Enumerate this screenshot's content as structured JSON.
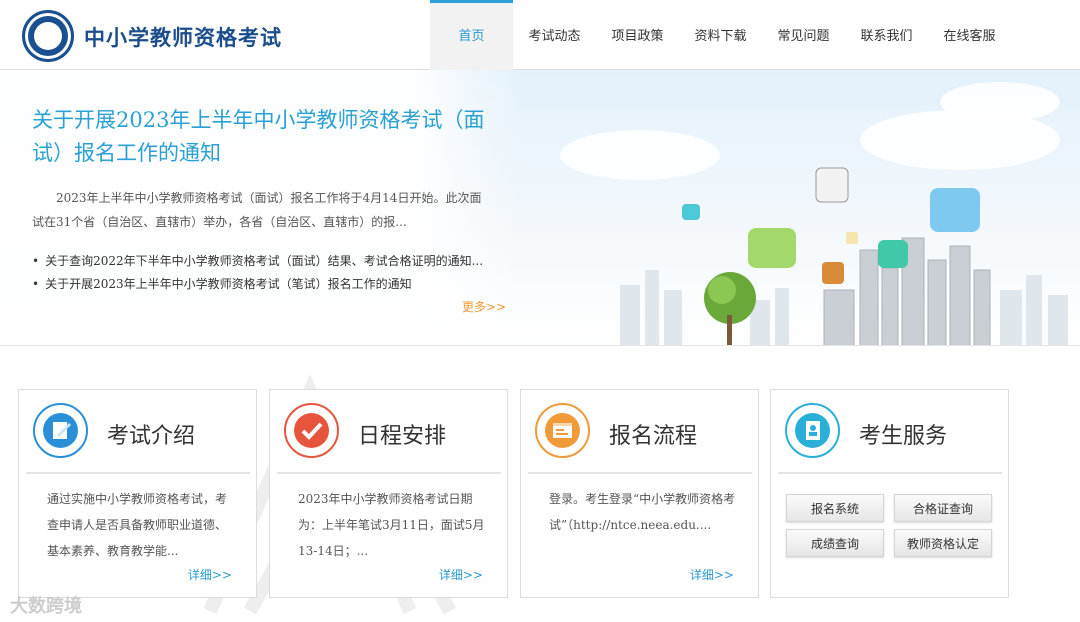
{
  "header": {
    "site_title": "中小学教师资格考试",
    "nav": [
      "首页",
      "考试动态",
      "项目政策",
      "资料下载",
      "常见问题",
      "联系我们",
      "在线客服"
    ]
  },
  "banner": {
    "title": "关于开展2023年上半年中小学教师资格考试（面试）报名工作的通知",
    "description": "2023年上半年中小学教师资格考试（面试）报名工作将于4月14日开始。此次面试在31个省（自治区、直辖市）举办，各省（自治区、直辖市）的报...",
    "news": [
      "关于查询2022年下半年中小学教师资格考试（面试）结果、考试合格证明的通知...",
      "关于开展2023年上半年中小学教师资格考试（笔试）报名工作的通知"
    ],
    "more": "更多>>"
  },
  "cards": [
    {
      "title": "考试介绍",
      "text": "通过实施中小学教师资格考试，考查申请人是否具备教师职业道德、基本素养、教育教学能...",
      "more": "详细>>"
    },
    {
      "title": "日程安排",
      "text": "2023年中小学教师资格考试日期为：上半年笔试3月11日，面试5月13-14日；...",
      "more": "详细>>"
    },
    {
      "title": "报名流程",
      "text": "登录。考生登录“中小学教师资格考试”（http://ntce.neea.edu....",
      "more": "详细>>"
    },
    {
      "title": "考生服务",
      "buttons": [
        "报名系统",
        "合格证查询",
        "成绩查询",
        "教师资格认定"
      ]
    }
  ],
  "watermark": "大数跨境",
  "colors": {
    "accent": "#2aa0d4",
    "brand": "#1d4d8c",
    "more": "#f39a33",
    "card1": "#2b8fd8",
    "card2": "#e8553e",
    "card3": "#f09a3a",
    "card4": "#2ab0d8"
  }
}
